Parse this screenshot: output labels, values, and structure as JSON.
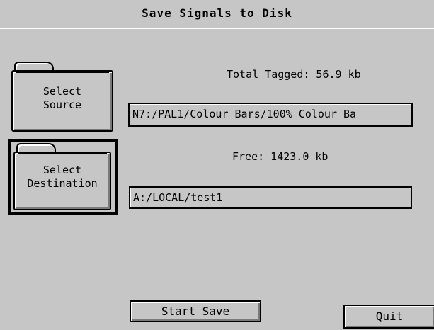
{
  "window": {
    "title": "Save Signals to Disk"
  },
  "source": {
    "button_label_line1": "Select",
    "button_label_line2": "Source",
    "icon": "folder-icon",
    "path": "N7:/PAL1/Colour Bars/100% Colour  Ba"
  },
  "destination": {
    "button_label_line1": "Select",
    "button_label_line2": "Destination",
    "icon": "folder-icon",
    "path": "A:/LOCAL/test1"
  },
  "stats": {
    "total_tagged": "Total Tagged:  56.9 kb",
    "free": "Free: 1423.0 kb"
  },
  "actions": {
    "start_save_label": "Start Save",
    "quit_label": "Quit"
  },
  "colors": {
    "background": "#c6c6c6",
    "border": "#000000"
  }
}
